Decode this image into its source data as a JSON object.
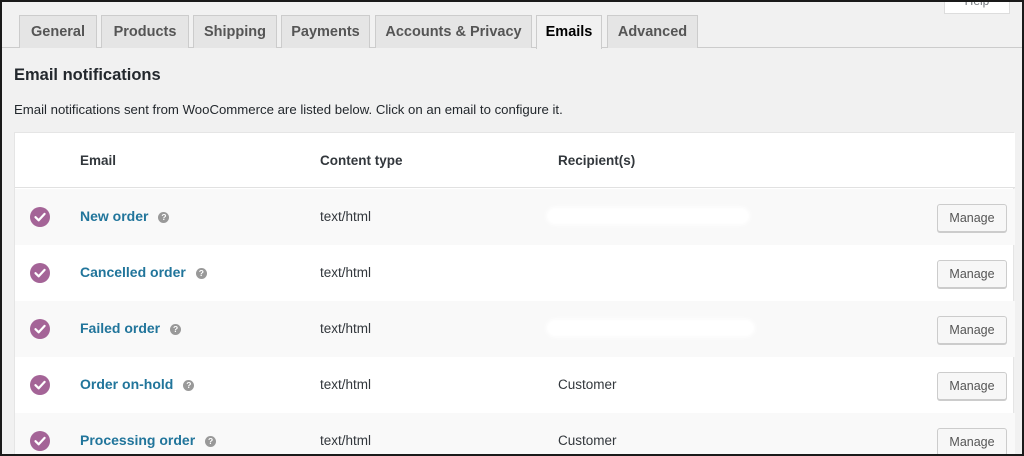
{
  "help_tab": {
    "label": "Help"
  },
  "tabs": [
    {
      "label": "General"
    },
    {
      "label": "Products"
    },
    {
      "label": "Shipping"
    },
    {
      "label": "Payments"
    },
    {
      "label": "Accounts & Privacy"
    },
    {
      "label": "Emails",
      "active": true
    },
    {
      "label": "Advanced"
    }
  ],
  "section": {
    "title": "Email notifications",
    "description": "Email notifications sent from WooCommerce are listed below. Click on an email to configure it."
  },
  "table": {
    "headers": {
      "email": "Email",
      "content_type": "Content type",
      "recipients": "Recipient(s)"
    },
    "rows": [
      {
        "name": "New order",
        "content_type": "text/html",
        "recipient": "",
        "recipient_redacted": true,
        "enabled": true,
        "action": "Manage"
      },
      {
        "name": "Cancelled order",
        "content_type": "text/html",
        "recipient": "",
        "recipient_redacted": false,
        "enabled": true,
        "action": "Manage"
      },
      {
        "name": "Failed order",
        "content_type": "text/html",
        "recipient": "",
        "recipient_redacted": true,
        "enabled": true,
        "action": "Manage"
      },
      {
        "name": "Order on-hold",
        "content_type": "text/html",
        "recipient": "Customer",
        "recipient_redacted": false,
        "enabled": true,
        "action": "Manage"
      },
      {
        "name": "Processing order",
        "content_type": "text/html",
        "recipient": "Customer",
        "recipient_redacted": false,
        "enabled": true,
        "action": "Manage"
      }
    ]
  },
  "icons": {
    "status": "checkmark-circle-icon",
    "help": "question-icon"
  },
  "colors": {
    "status_enabled": "#a46497",
    "link": "#21759b",
    "page_bg": "#f1f1f1"
  }
}
